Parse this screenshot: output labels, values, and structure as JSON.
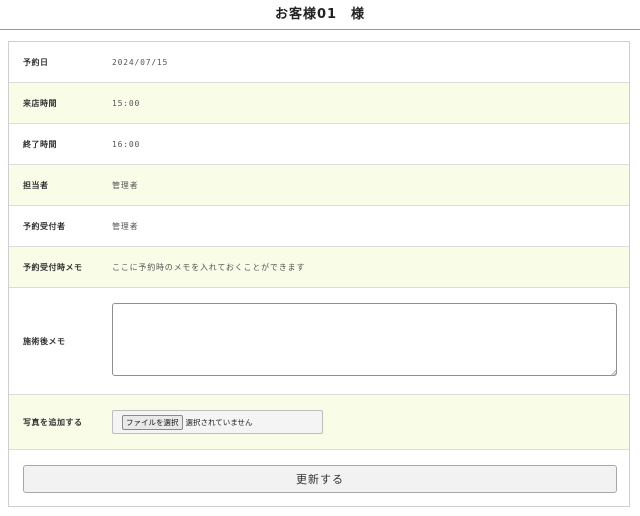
{
  "page": {
    "title": "お客様01　様"
  },
  "form": {
    "rows": [
      {
        "label": "予約日",
        "value": "2024/07/15"
      },
      {
        "label": "来店時間",
        "value": "15:00"
      },
      {
        "label": "終了時間",
        "value": "16:00"
      },
      {
        "label": "担当者",
        "value": "管理者"
      },
      {
        "label": "予約受付者",
        "value": "管理者"
      },
      {
        "label": "予約受付時メモ",
        "value": "ここに予約時のメモを入れておくことができます"
      }
    ],
    "memo": {
      "label": "施術後メモ",
      "value": ""
    },
    "photo": {
      "label": "写真を追加する",
      "button_label": "ファイルを選択",
      "status": "選択されていません"
    },
    "submit_label": "更新する"
  },
  "colors": {
    "row_shade": "#f9fde8",
    "border": "#dcdcdc"
  }
}
